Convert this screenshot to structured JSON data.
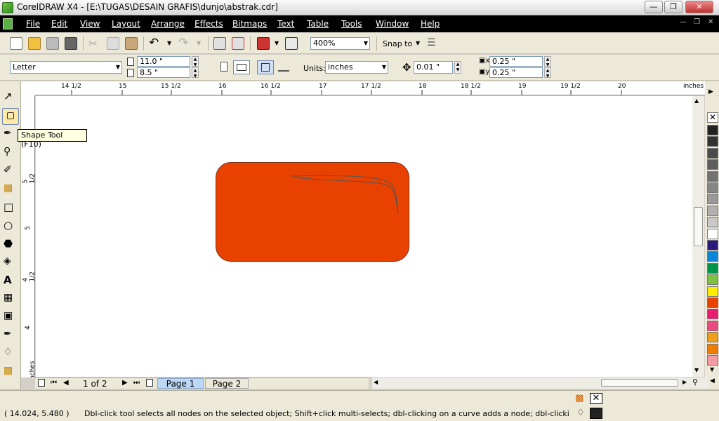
{
  "window": {
    "title": "CorelDRAW X4 - [E:\\TUGAS\\DESAIN GRAFIS\\dunjo\\abstrak.cdr]"
  },
  "menu": [
    "File",
    "Edit",
    "View",
    "Layout",
    "Arrange",
    "Effects",
    "Bitmaps",
    "Text",
    "Table",
    "Tools",
    "Window",
    "Help"
  ],
  "toolbar": {
    "zoom_level": "400%",
    "snap_label": "Snap to"
  },
  "property_bar": {
    "paper_preset": "Letter",
    "page_width": "11.0 \"",
    "page_height": "8.5 \"",
    "units_label": "Units:",
    "units_value": "inches",
    "nudge": "0.01 \"",
    "duplicate_x": "0.25 \"",
    "duplicate_y": "0.25 \""
  },
  "tooltip": {
    "text": "Shape Tool (F10)"
  },
  "ruler_h": {
    "labels": [
      "14 1/2",
      "15",
      "15 1/2",
      "16",
      "16 1/2",
      "17",
      "17 1/2",
      "18",
      "18 1/2",
      "19",
      "19 1/2",
      "20"
    ],
    "unit": "inches"
  },
  "ruler_v": {
    "labels": [
      "5 1/2",
      "5",
      "4 1/2",
      "4"
    ],
    "unit": "inches"
  },
  "pages": {
    "counter": "1 of 2",
    "tabs": [
      "Page 1",
      "Page 2"
    ]
  },
  "status": {
    "coords": "( 14.024, 5.480 )",
    "message": "Dbl-click tool selects all nodes on the selected object; Shift+click multi-selects; dbl-clicking on a curve adds a node; dbl-clicking on a node remo..."
  },
  "colors": {
    "accent_fill": "#e94100",
    "palette": [
      "#222222",
      "#333333",
      "#4a4a4a",
      "#5e5e5e",
      "#727272",
      "#868686",
      "#9a9a9a",
      "#b0b0b0",
      "#c8c8c8",
      "#ffffff",
      "#2a1a7a",
      "#0c86d8",
      "#00964a",
      "#7fc142",
      "#ffed00",
      "#e94100",
      "#e81e6e",
      "#e94a82",
      "#f0a020",
      "#f07c00",
      "#f49aa4"
    ]
  }
}
